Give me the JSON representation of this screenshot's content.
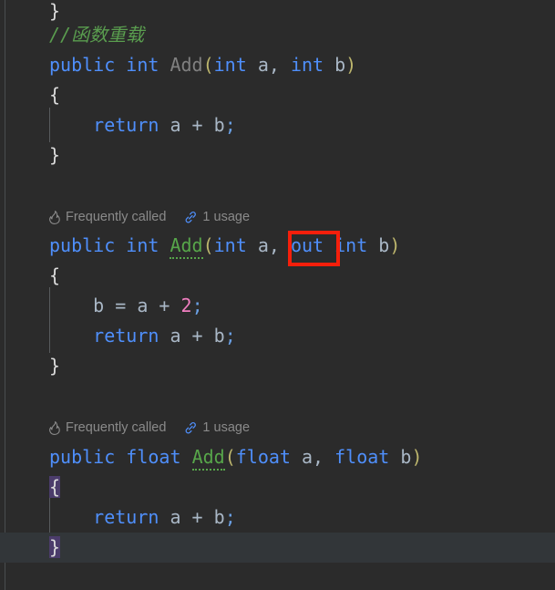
{
  "editor": {
    "name": "code-editor",
    "language": "csharp",
    "background_color": "#2b2b2b",
    "current_line_color": "#323639",
    "font_size_px": 20,
    "colors": {
      "keyword": "#4f8ffb",
      "identifier": "#a9b7c6",
      "method_unused": "#808080",
      "method_used": "#57a64a",
      "number": "#f07ec0",
      "comment": "#5a9e4f",
      "brace": "#dcdcdc",
      "paren": "#bdb66d",
      "semicolon": "#6a9fe3",
      "brace_match_highlight": "#4b3c6b",
      "hint_text": "#8a8a8a",
      "link_icon": "#4f8ffb",
      "annotation_box": "#f61f0b"
    }
  },
  "code_lines": [
    {
      "id": "line-1",
      "tokens": [
        {
          "t": "}",
          "c": "brace"
        }
      ]
    },
    {
      "id": "line-2",
      "tokens": [
        {
          "t": "//函数重载",
          "c": "comment"
        }
      ]
    },
    {
      "id": "line-3",
      "tokens": [
        {
          "t": "public",
          "c": "kw"
        },
        {
          "t": " ",
          "c": "punct"
        },
        {
          "t": "int",
          "c": "kw"
        },
        {
          "t": " ",
          "c": "punct"
        },
        {
          "t": "Add",
          "c": "fn-dim"
        },
        {
          "t": "(",
          "c": "paren"
        },
        {
          "t": "int",
          "c": "kw"
        },
        {
          "t": " ",
          "c": "punct"
        },
        {
          "t": "a",
          "c": "ident"
        },
        {
          "t": ", ",
          "c": "punct"
        },
        {
          "t": "int",
          "c": "kw"
        },
        {
          "t": " ",
          "c": "punct"
        },
        {
          "t": "b",
          "c": "ident"
        },
        {
          "t": ")",
          "c": "paren"
        }
      ]
    },
    {
      "id": "line-4",
      "tokens": [
        {
          "t": "{",
          "c": "brace"
        }
      ]
    },
    {
      "id": "line-5",
      "tokens": [
        {
          "t": "    ",
          "c": "punct"
        },
        {
          "t": "return",
          "c": "kw"
        },
        {
          "t": " ",
          "c": "punct"
        },
        {
          "t": "a",
          "c": "ident"
        },
        {
          "t": " + ",
          "c": "punct"
        },
        {
          "t": "b",
          "c": "ident"
        },
        {
          "t": ";",
          "c": "semi"
        }
      ]
    },
    {
      "id": "line-6",
      "tokens": [
        {
          "t": "}",
          "c": "brace"
        }
      ]
    },
    {
      "id": "line-7",
      "tokens": []
    },
    {
      "id": "line-8",
      "tokens": []
    },
    {
      "id": "line-9",
      "tokens": [
        {
          "t": "public",
          "c": "kw"
        },
        {
          "t": " ",
          "c": "punct"
        },
        {
          "t": "int",
          "c": "kw"
        },
        {
          "t": " ",
          "c": "punct"
        },
        {
          "t": "Add",
          "c": "fn-used"
        },
        {
          "t": "(",
          "c": "paren"
        },
        {
          "t": "int",
          "c": "kw"
        },
        {
          "t": " ",
          "c": "punct"
        },
        {
          "t": "a",
          "c": "ident"
        },
        {
          "t": ", ",
          "c": "punct"
        },
        {
          "t": "out",
          "c": "kw"
        },
        {
          "t": " ",
          "c": "punct"
        },
        {
          "t": "int",
          "c": "kw"
        },
        {
          "t": " ",
          "c": "punct"
        },
        {
          "t": "b",
          "c": "ident"
        },
        {
          "t": ")",
          "c": "paren"
        }
      ]
    },
    {
      "id": "line-10",
      "tokens": [
        {
          "t": "{",
          "c": "brace"
        }
      ]
    },
    {
      "id": "line-11",
      "tokens": [
        {
          "t": "    ",
          "c": "punct"
        },
        {
          "t": "b",
          "c": "ident"
        },
        {
          "t": " = ",
          "c": "punct"
        },
        {
          "t": "a",
          "c": "ident"
        },
        {
          "t": " + ",
          "c": "punct"
        },
        {
          "t": "2",
          "c": "num"
        },
        {
          "t": ";",
          "c": "semi"
        }
      ]
    },
    {
      "id": "line-12",
      "tokens": [
        {
          "t": "    ",
          "c": "punct"
        },
        {
          "t": "return",
          "c": "kw"
        },
        {
          "t": " ",
          "c": "punct"
        },
        {
          "t": "a",
          "c": "ident"
        },
        {
          "t": " + ",
          "c": "punct"
        },
        {
          "t": "b",
          "c": "ident"
        },
        {
          "t": ";",
          "c": "semi"
        }
      ]
    },
    {
      "id": "line-13",
      "tokens": [
        {
          "t": "}",
          "c": "brace"
        }
      ]
    },
    {
      "id": "line-14",
      "tokens": []
    },
    {
      "id": "line-15",
      "tokens": []
    },
    {
      "id": "line-16",
      "tokens": [
        {
          "t": "public",
          "c": "kw"
        },
        {
          "t": " ",
          "c": "punct"
        },
        {
          "t": "float",
          "c": "kw"
        },
        {
          "t": " ",
          "c": "punct"
        },
        {
          "t": "Add",
          "c": "fn-used"
        },
        {
          "t": "(",
          "c": "paren"
        },
        {
          "t": "float",
          "c": "kw"
        },
        {
          "t": " ",
          "c": "punct"
        },
        {
          "t": "a",
          "c": "ident"
        },
        {
          "t": ", ",
          "c": "punct"
        },
        {
          "t": "float",
          "c": "kw"
        },
        {
          "t": " ",
          "c": "punct"
        },
        {
          "t": "b",
          "c": "ident"
        },
        {
          "t": ")",
          "c": "paren"
        }
      ]
    },
    {
      "id": "line-17",
      "tokens": [
        {
          "t": "{",
          "c": "brace-hl"
        }
      ]
    },
    {
      "id": "line-18",
      "tokens": [
        {
          "t": "    ",
          "c": "punct"
        },
        {
          "t": "return",
          "c": "kw"
        },
        {
          "t": " ",
          "c": "punct"
        },
        {
          "t": "a",
          "c": "ident"
        },
        {
          "t": " + ",
          "c": "punct"
        },
        {
          "t": "b",
          "c": "ident"
        },
        {
          "t": ";",
          "c": "semi"
        }
      ]
    },
    {
      "id": "line-19",
      "tokens": [
        {
          "t": "}",
          "c": "brace-hl"
        }
      ],
      "current": true
    }
  ],
  "inlay_hints": [
    {
      "id": "hint-above-int-out",
      "frequently_called_label": "Frequently called",
      "usage_label": "1 usage",
      "flame_icon": "flame-icon",
      "link_icon": "link-icon"
    },
    {
      "id": "hint-above-float",
      "frequently_called_label": "Frequently called",
      "usage_label": "1 usage",
      "flame_icon": "flame-icon",
      "link_icon": "link-icon"
    }
  ],
  "annotation": {
    "name": "out-keyword-highlight-box",
    "target_text": "out",
    "color": "#f61f0b"
  }
}
